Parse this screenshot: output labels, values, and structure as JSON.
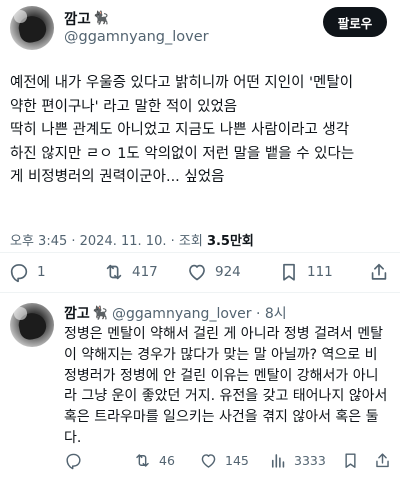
{
  "main_tweet": {
    "author": {
      "display_name": "깜고",
      "emoji": "🐈‍⬛",
      "handle": "@ggamnyang_lover"
    },
    "follow_label": "팔로우",
    "text_lines": [
      "예전에 내가 우울증 있다고 밝히니까 어떤 지인이 '멘탈이",
      "약한 편이구나' 라고 말한 적이 있었음",
      "딱히 나쁜 관계도 아니었고 지금도 나쁜 사람이라고 생각",
      "하진 않지만 ㄹㅇ 1도 악의없이 저런 말을 뱉을 수 있다는",
      "게 비정병러의 권력이군아... 싶었음"
    ],
    "timestamp": "오후 3:45 · 2024. 11. 10. · 조회",
    "views": "3.5만회",
    "stats": {
      "replies": "1",
      "retweets": "417",
      "likes": "924",
      "bookmarks": "111"
    }
  },
  "reply_tweet": {
    "author": {
      "display_name": "깜고",
      "emoji": "🐈‍⬛",
      "handle": "@ggamnyang_lover · 8시"
    },
    "text_lines": [
      "정병은 멘탈이 약해서 걸린 게 아니라 정병 걸려서 멘탈",
      "이 약해지는 경우가 많다가 맞는 말 아닐까? 역으로 비",
      "정병러가 정병에 안 걸린 이유는 멘탈이 강해서가 아니",
      "라 그냥 운이 좋았던 거지. 유전을 갖고 태어나지 않아서",
      "혹은 트라우마를 일으키는 사건을 겪지 않아서 혹은 둘",
      "다."
    ],
    "stats": {
      "retweets": "46",
      "likes": "145",
      "views": "3333"
    }
  },
  "colors": {
    "text": "#0f1419",
    "secondary": "#536471",
    "divider": "#eff3f4",
    "button_bg": "#0f1419"
  },
  "icons": [
    "reply-icon",
    "retweet-icon",
    "like-icon",
    "views-icon",
    "bookmark-icon",
    "share-icon"
  ]
}
